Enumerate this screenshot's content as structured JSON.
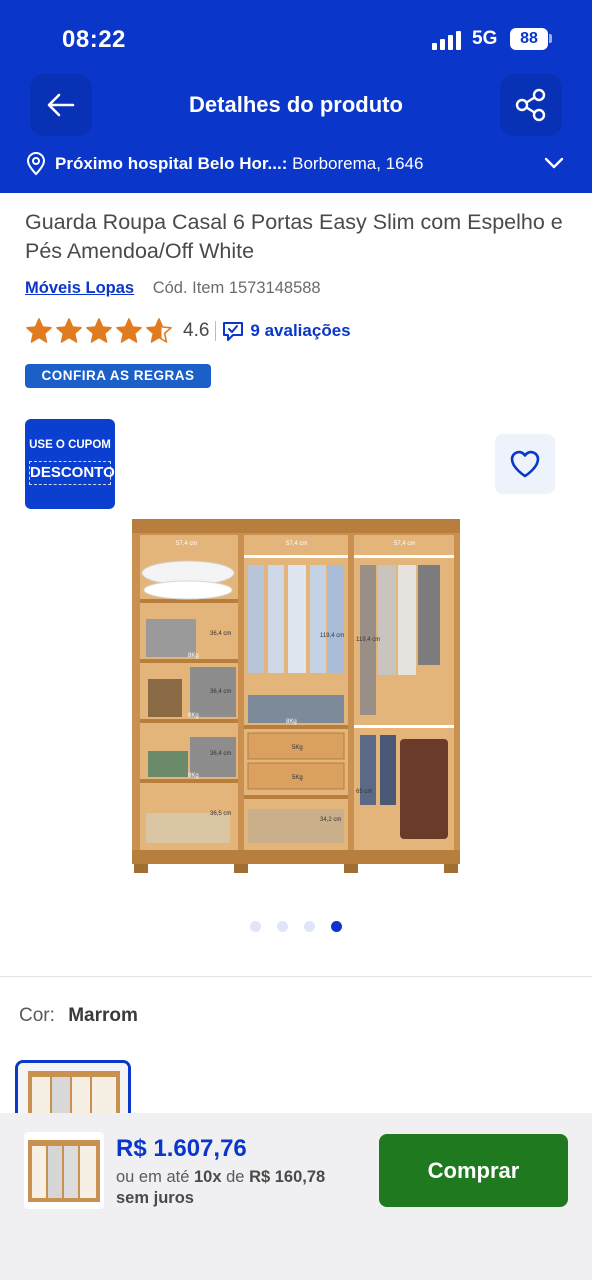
{
  "status_bar": {
    "time": "08:22",
    "network": "5G",
    "battery": "88"
  },
  "nav": {
    "title": "Detalhes do produto",
    "back_icon": "arrow-left-icon",
    "share_icon": "share-icon"
  },
  "location": {
    "label": "Próximo hospital Belo Hor...:",
    "address": "Borborema, 1646"
  },
  "product": {
    "title": "Guarda Roupa Casal 6 Portas Easy Slim com Espelho e Pés Amendoa/Off White",
    "seller": "Móveis Lopas",
    "item_code": "Cód. Item 1573148588",
    "rating": "4.6",
    "rating_value": 4.6,
    "reviews": "9 avaliações",
    "rules_badge": "CONFIRA AS REGRAS",
    "star_color": "#e07b1f"
  },
  "gallery": {
    "coupon_top": "USE O CUPOM",
    "coupon_main": "DESCONTO",
    "dots_total": 4,
    "active_index": 3,
    "image_labels": {
      "width_left": "57,4 cm",
      "width_mid": "57,4 cm",
      "width_right": "57,4 cm",
      "h1": "36,4 cm",
      "h2": "36,4 cm",
      "h3": "36,4 cm",
      "h4": "36,5 cm",
      "hang_mid": "119,4 cm",
      "hang_right": "119,4 cm",
      "lower_right": "65 cm",
      "shoe_mid": "34,2 cm",
      "w1": "8Kg",
      "w2": "8Kg",
      "w3": "8Kg",
      "w4": "8Kg",
      "w5": "8Kg",
      "drawer1": "5Kg",
      "drawer2": "5Kg"
    }
  },
  "color": {
    "label": "Cor:",
    "value": "Marrom"
  },
  "purchase": {
    "price": "R$ 1.607,76",
    "installment_prefix": "ou em até",
    "installment_count": "10x",
    "installment_mid": "de",
    "installment_value": "R$ 160,78",
    "installment_suffix": "sem juros",
    "buy_label": "Comprar"
  },
  "colors": {
    "brand_blue": "#0a37c9",
    "buy_green": "#1f7a1f",
    "wood": "#c9904f"
  }
}
